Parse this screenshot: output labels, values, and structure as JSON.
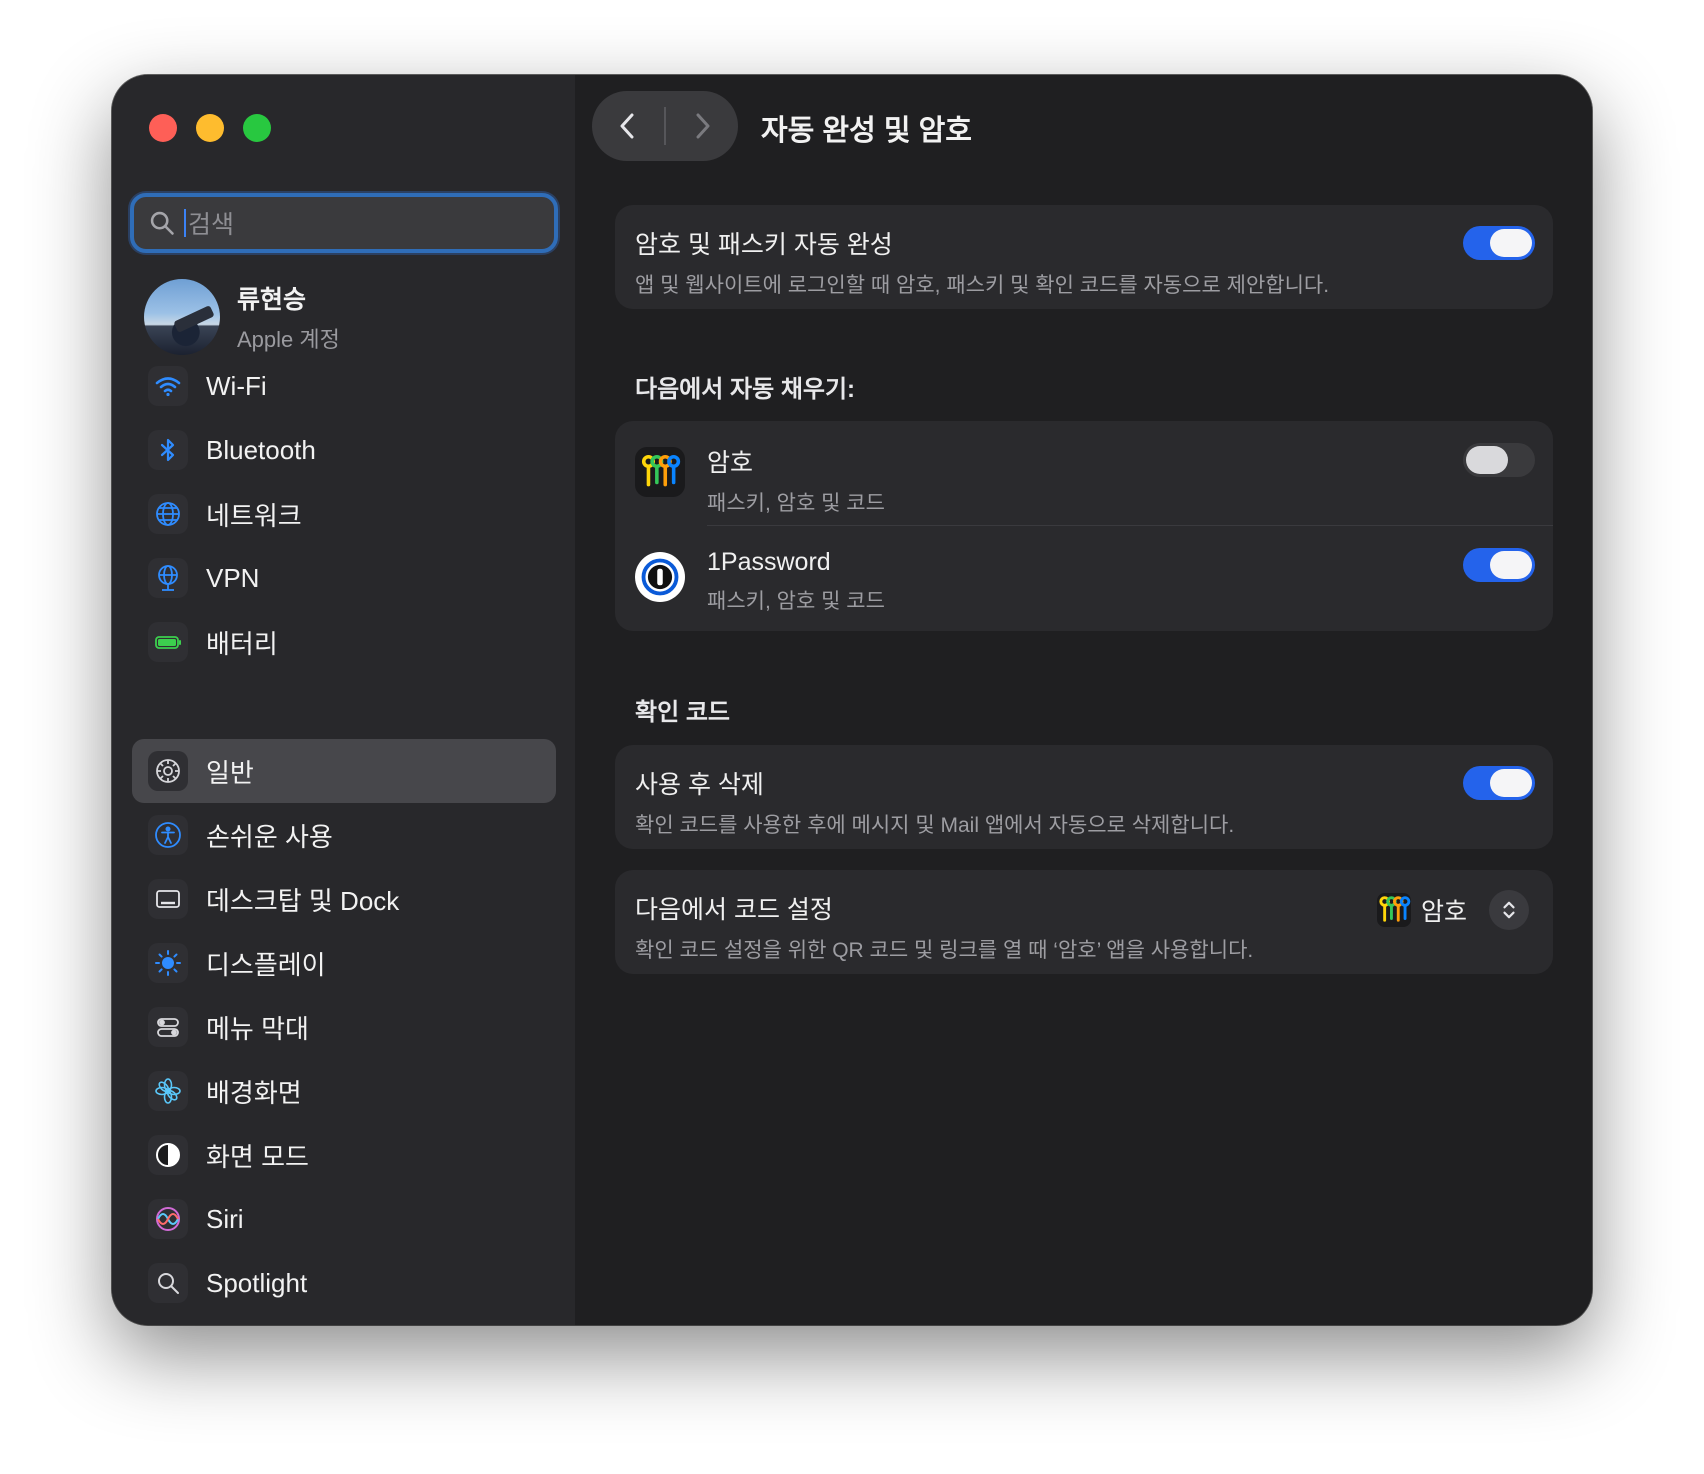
{
  "window": {
    "title": "자동 완성 및 암호"
  },
  "search": {
    "placeholder": "검색"
  },
  "account": {
    "name": "류현승",
    "subtitle": "Apple 계정"
  },
  "sidebar": {
    "group1": [
      {
        "label": "Wi-Fi",
        "icon": "wifi-icon"
      },
      {
        "label": "Bluetooth",
        "icon": "bluetooth-icon"
      },
      {
        "label": "네트워크",
        "icon": "globe-icon"
      },
      {
        "label": "VPN",
        "icon": "vpn-globe-icon"
      },
      {
        "label": "배터리",
        "icon": "battery-icon"
      }
    ],
    "group2": [
      {
        "label": "일반",
        "icon": "gear-icon",
        "selected": true
      },
      {
        "label": "손쉬운 사용",
        "icon": "accessibility-icon"
      },
      {
        "label": "데스크탑 및 Dock",
        "icon": "dock-icon"
      },
      {
        "label": "디스플레이",
        "icon": "brightness-icon"
      },
      {
        "label": "메뉴 막대",
        "icon": "menubar-toggle-icon"
      },
      {
        "label": "배경화면",
        "icon": "wallpaper-flower-icon"
      },
      {
        "label": "화면 모드",
        "icon": "screen-mode-icon"
      },
      {
        "label": "Siri",
        "icon": "siri-icon"
      },
      {
        "label": "Spotlight",
        "icon": "magnifier-icon"
      }
    ]
  },
  "main": {
    "autofill_card": {
      "title": "암호 및 패스키 자동 완성",
      "subtitle": "앱 및 웹사이트에 로그인할 때 암호, 패스키 및 확인 코드를 자동으로 제안합니다.",
      "enabled": true
    },
    "fill_from": {
      "section_title": "다음에서 자동 채우기:",
      "items": [
        {
          "title": "암호",
          "subtitle": "패스키, 암호 및 코드",
          "icon": "passwords-keys-icon",
          "enabled": false
        },
        {
          "title": "1Password",
          "subtitle": "패스키, 암호 및 코드",
          "icon": "1password-icon",
          "enabled": true
        }
      ]
    },
    "verification": {
      "section_title": "확인 코드",
      "delete_after_use": {
        "title": "사용 후 삭제",
        "subtitle": "확인 코드를 사용한 후에 메시지 및 Mail 앱에서 자동으로 삭제합니다.",
        "enabled": true
      },
      "setup_codes": {
        "title": "다음에서 코드 설정",
        "subtitle": "확인 코드 설정을 위한 QR 코드 및 링크를 열 때 ‘암호’ 앱을 사용합니다.",
        "selected_app": "암호"
      }
    }
  },
  "colors": {
    "accent": "#2463eb",
    "traffic_red": "#fe5f57",
    "traffic_yellow": "#febc2e",
    "traffic_green": "#28c840"
  }
}
